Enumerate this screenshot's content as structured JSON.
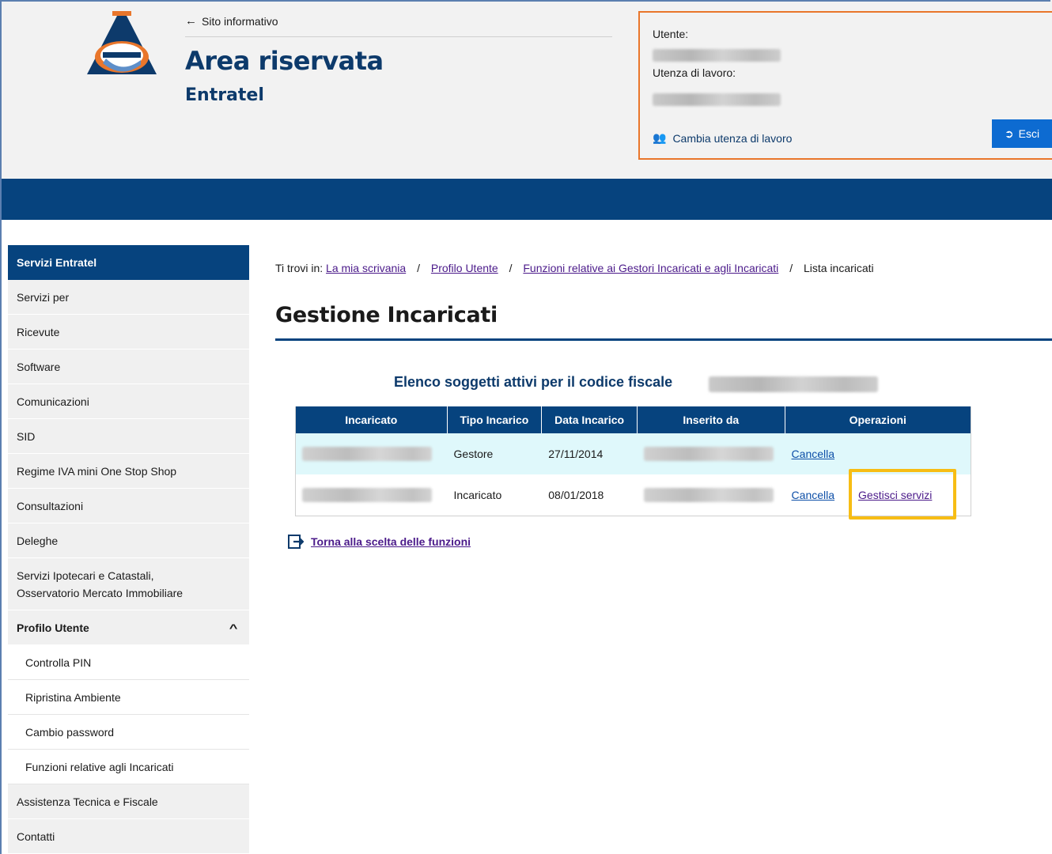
{
  "header": {
    "back_link": "Sito informativo",
    "title": "Area riservata",
    "subtitle": "Entratel"
  },
  "user_box": {
    "utente_label": "Utente:",
    "utenza_label": "Utenza di lavoro:",
    "cambia_label": "Cambia utenza di lavoro",
    "esci_label": "Esci"
  },
  "sidebar": {
    "heading": "Servizi Entratel",
    "items": [
      "Servizi per",
      "Ricevute",
      "Software",
      "Comunicazioni",
      "SID",
      "Regime IVA mini One Stop Shop",
      "Consultazioni",
      "Deleghe"
    ],
    "ipotecari_line1": "Servizi Ipotecari e Catastali,",
    "ipotecari_line2": "Osservatorio Mercato Immobiliare",
    "profilo": "Profilo Utente",
    "profilo_subitems": [
      "Controlla PIN",
      "Ripristina Ambiente",
      "Cambio password",
      "Funzioni relative agli Incaricati"
    ],
    "assistenza": "Assistenza Tecnica e Fiscale",
    "contatti": "Contatti"
  },
  "breadcrumb": {
    "prefix": "Ti trovi in:",
    "crumbs": [
      "La mia scrivania",
      "Profilo Utente",
      "Funzioni relative ai Gestori Incaricati e agli Incaricati"
    ],
    "current": "Lista incaricati",
    "separator": "/"
  },
  "page": {
    "title": "Gestione Incaricati",
    "list_heading": "Elenco soggetti attivi per il codice fiscale"
  },
  "table": {
    "headers": [
      "Incaricato",
      "Tipo Incarico",
      "Data Incarico",
      "Inserito da",
      "Operazioni"
    ],
    "rows": [
      {
        "tipo": "Gestore",
        "data": "27/11/2014",
        "cancella": "Cancella"
      },
      {
        "tipo": "Incaricato",
        "data": "08/01/2018",
        "cancella": "Cancella",
        "gestisci": "Gestisci servizi"
      }
    ]
  },
  "torna_label": "Torna alla scelta delle funzioni",
  "colors": {
    "brand_navy": "#06437e",
    "title_blue": "#0d3a6b",
    "button_blue": "#0d6bd1",
    "user_box_border": "#e9762b",
    "highlight": "#f7bd14",
    "row_alt": "#dff8fb"
  },
  "icons": [
    "agenzia-entrate-logo",
    "arrow-left-icon",
    "users-icon",
    "sign-out-icon",
    "chevron-up-icon",
    "return-icon"
  ]
}
